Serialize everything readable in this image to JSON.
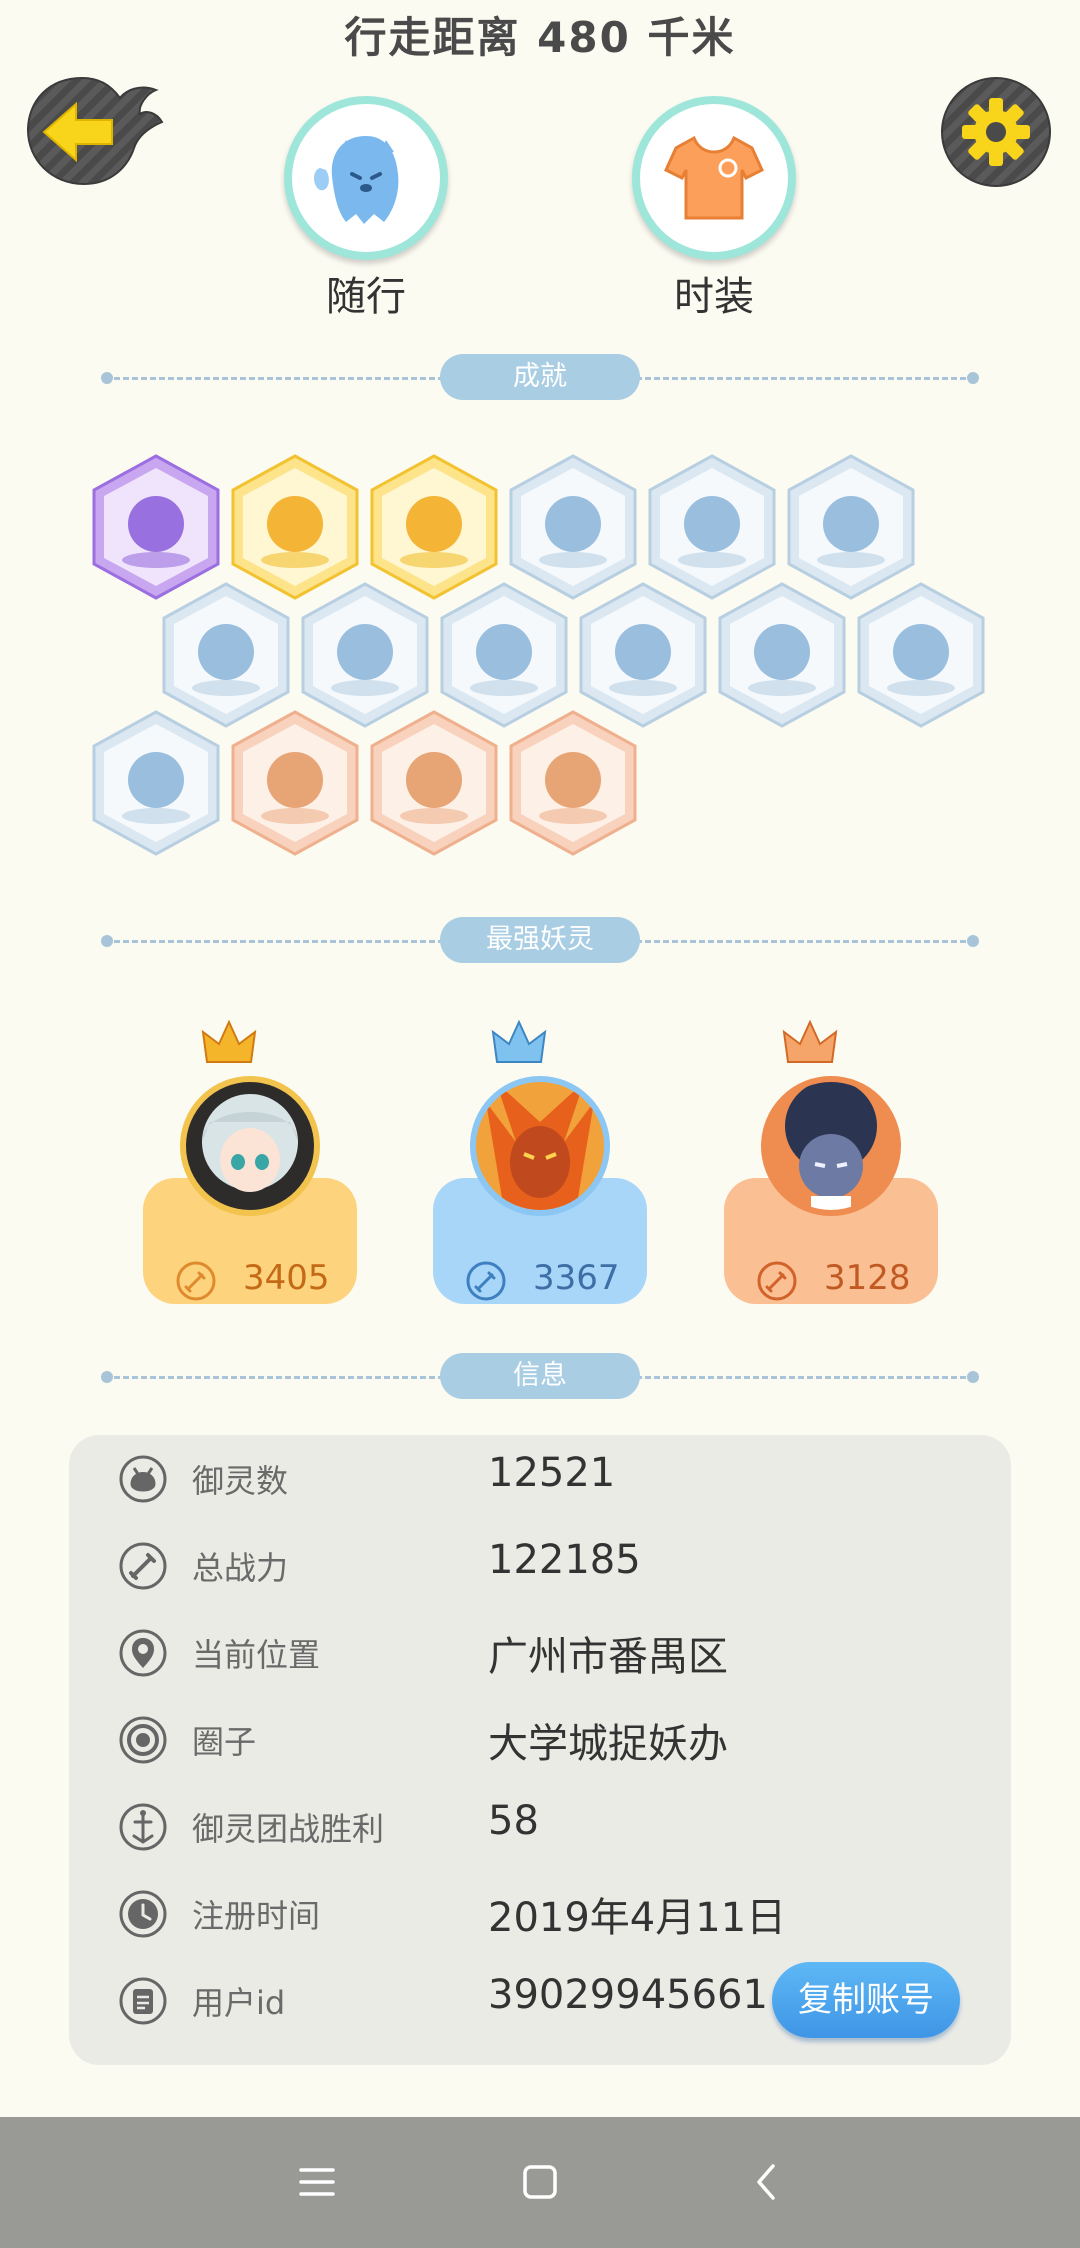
{
  "header": {
    "title": "行走距离 480 千米"
  },
  "top_items": [
    {
      "label": "随行",
      "icon": "ghost-companion-icon"
    },
    {
      "label": "时装",
      "icon": "tshirt-icon"
    }
  ],
  "sections": {
    "achievements": "成就",
    "strongest": "最强妖灵",
    "info": "信息"
  },
  "achievements": {
    "rows": [
      [
        "purple-demon-badge",
        "golden-orb-badge",
        "yinyang-fireball-badge",
        "sneaker-badge",
        "portal-signpost-badge",
        "moon-badge"
      ],
      [
        "crystal-badge",
        "ice-spirit-badge",
        "cat-spirit-badge",
        "yinyang-box-badge",
        "dragon-badge",
        "shield-badge"
      ],
      [
        "blue-creature-badge",
        "stroller-cat-badge",
        "ox-spirit-badge",
        "fox-book-badge"
      ]
    ],
    "tiers": [
      [
        "purple",
        "gold",
        "gold",
        "blue",
        "blue",
        "blue"
      ],
      [
        "blue",
        "blue",
        "blue",
        "blue",
        "blue",
        "blue"
      ],
      [
        "blue",
        "orange",
        "orange",
        "orange"
      ]
    ]
  },
  "spirits": [
    {
      "power": "3405",
      "tier": "gold"
    },
    {
      "power": "3367",
      "tier": "blue"
    },
    {
      "power": "3128",
      "tier": "orange"
    }
  ],
  "info": {
    "rows": [
      {
        "icon": "spirit-count-icon",
        "label": "御灵数",
        "value": "12521"
      },
      {
        "icon": "sword-icon",
        "label": "总战力",
        "value": "122185"
      },
      {
        "icon": "location-pin-icon",
        "label": "当前位置",
        "value": "广州市番禺区"
      },
      {
        "icon": "circle-group-icon",
        "label": "圈子",
        "value": "大学城捉妖办"
      },
      {
        "icon": "team-battle-icon",
        "label": "御灵团战胜利",
        "value": "58"
      },
      {
        "icon": "clock-icon",
        "label": "注册时间",
        "value": "2019年4月11日"
      },
      {
        "icon": "id-card-icon",
        "label": "用户id",
        "value": "39029945661"
      }
    ],
    "copy_button": "复制账号"
  },
  "colors": {
    "background": "#fcfbf2",
    "divider": "#a9cde3",
    "gold": "#fdd37e",
    "blue": "#a8d6f8",
    "orange": "#fbbf94",
    "copy_button": "#4aa2ee"
  },
  "navbar": {
    "buttons": [
      "menu-icon",
      "home-icon",
      "back-icon"
    ]
  }
}
